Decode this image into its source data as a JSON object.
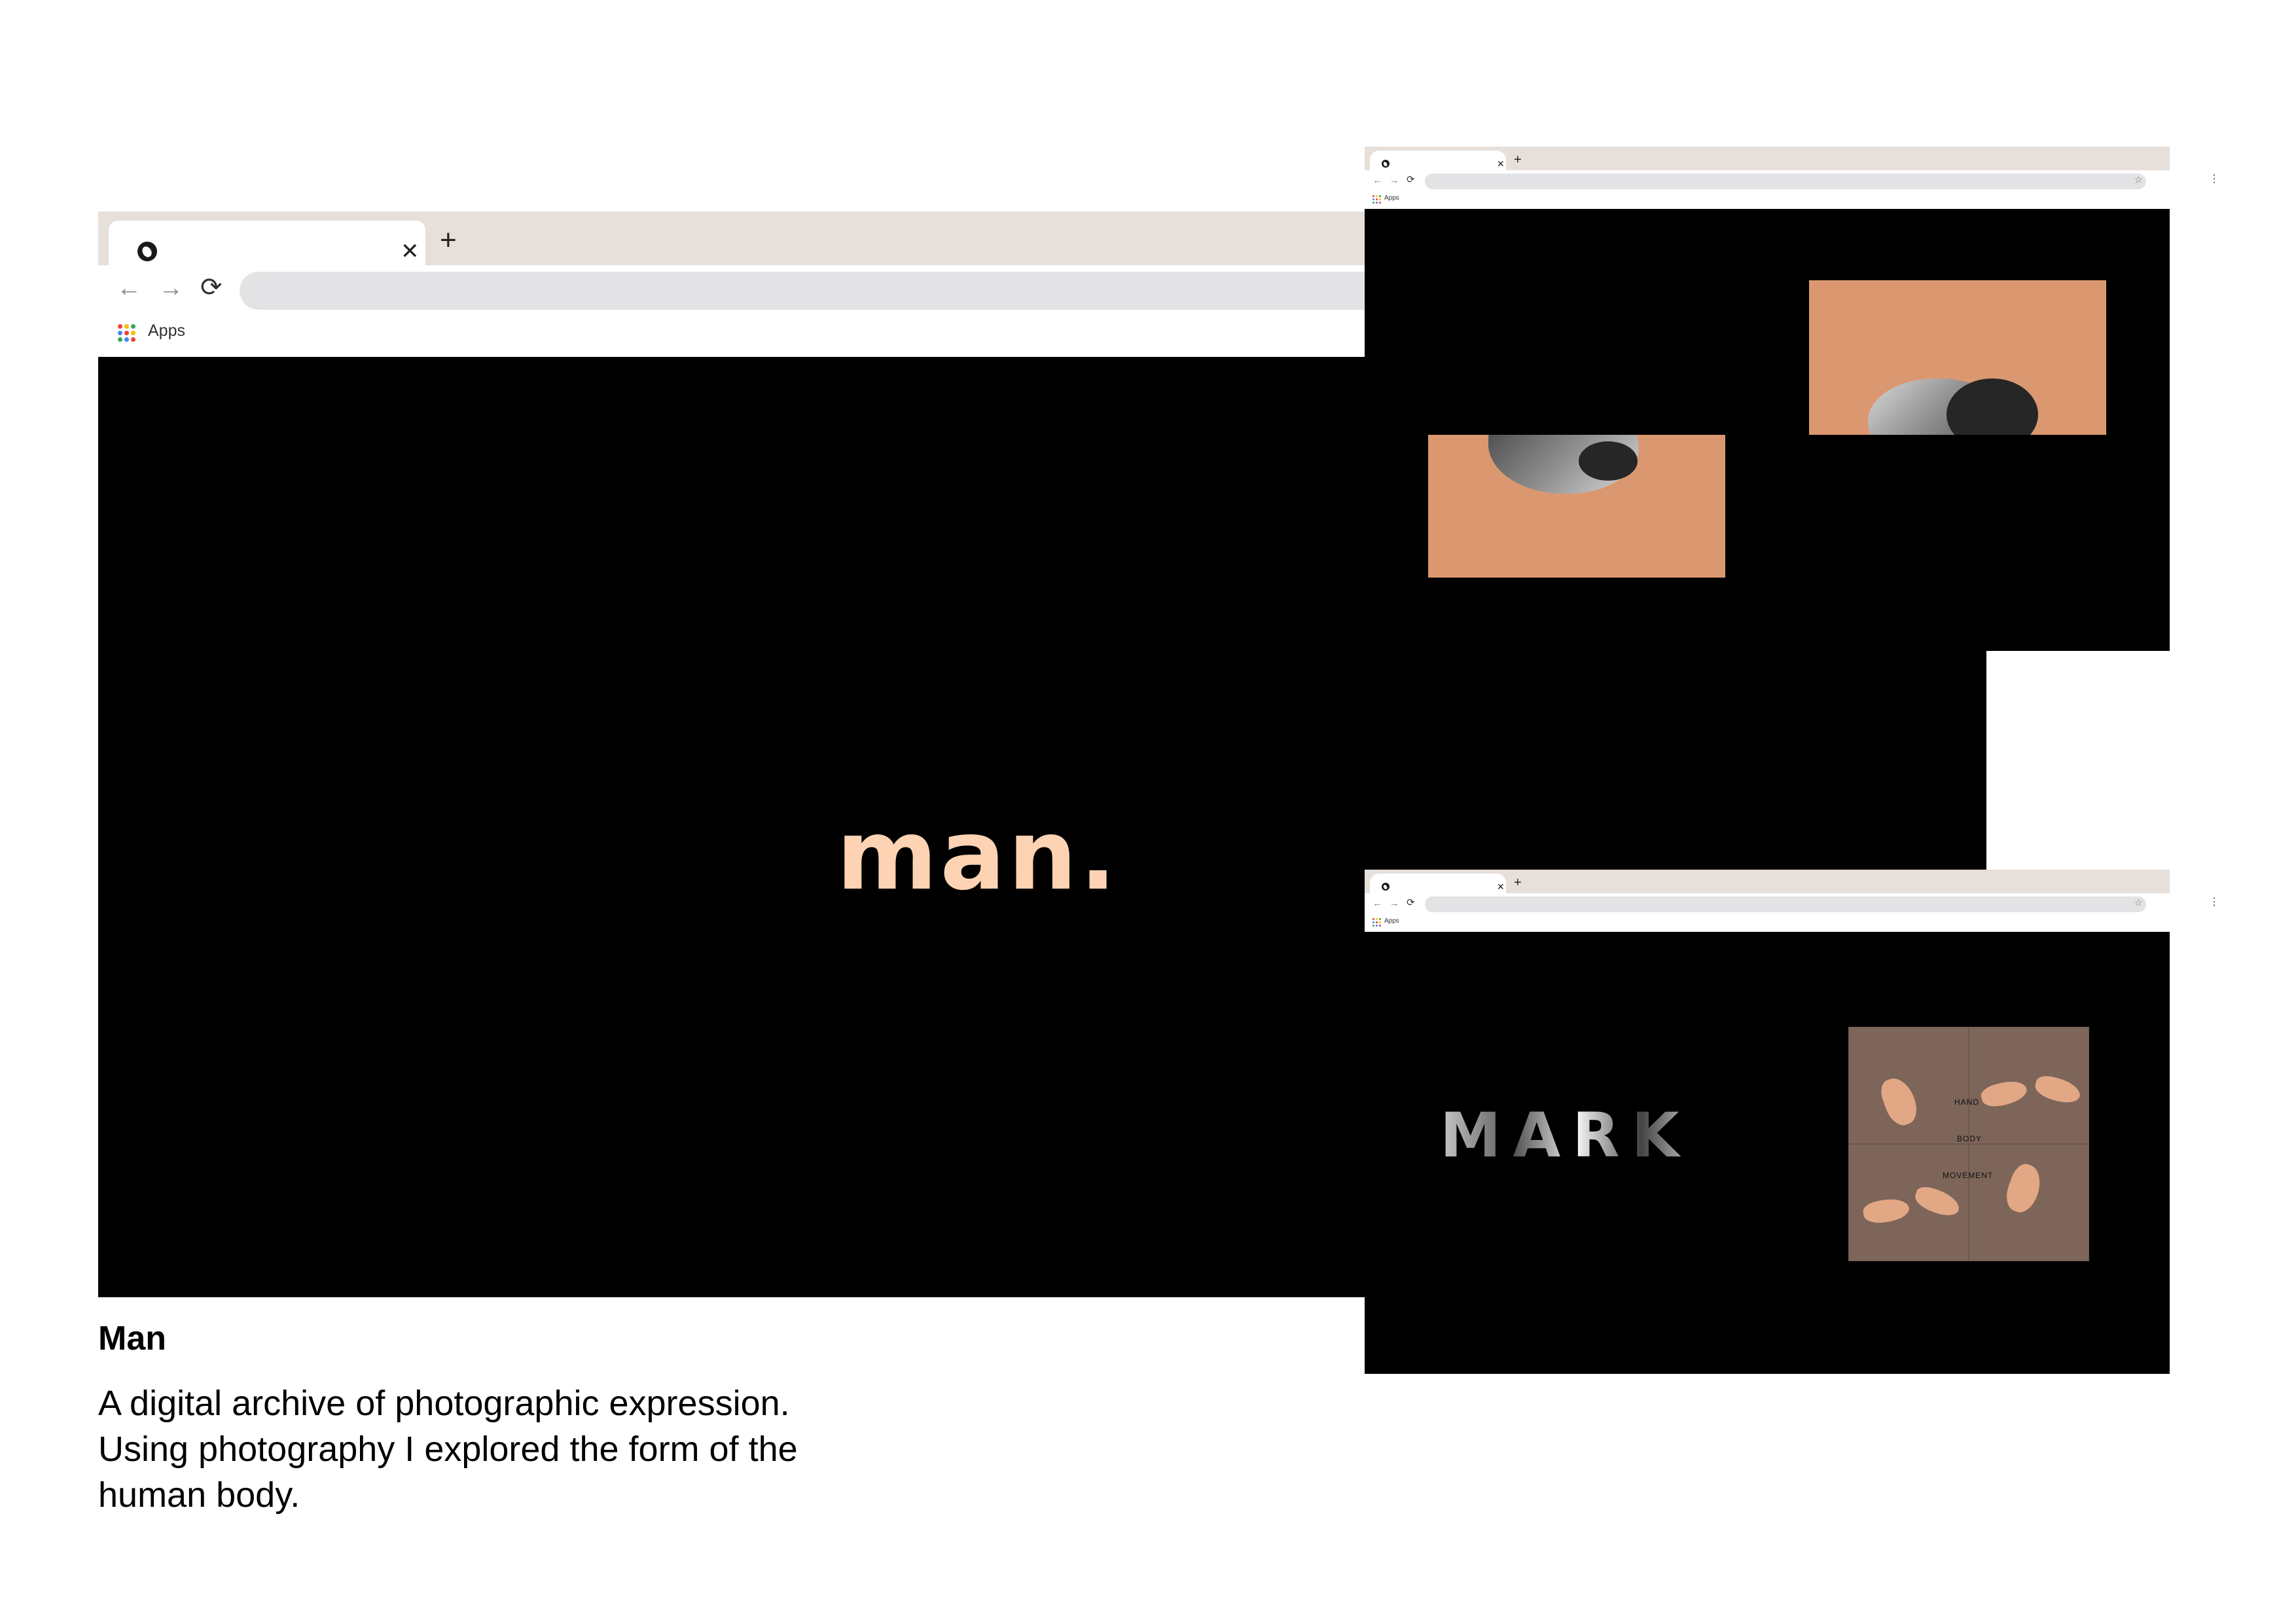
{
  "main_window": {
    "tab_close": "✕",
    "new_tab": "+",
    "nav": {
      "back": "←",
      "forward": "→",
      "reload": "⟳"
    },
    "bookmarks": {
      "apps_label": "Apps"
    },
    "page_word": "man."
  },
  "small_window_top": {
    "tab_close": "✕",
    "new_tab": "+",
    "nav": {
      "back": "←",
      "forward": "→",
      "reload": "⟳"
    },
    "bookmarks": {
      "apps_label": "Apps"
    }
  },
  "small_window_bottom": {
    "tab_close": "✕",
    "new_tab": "+",
    "nav": {
      "back": "←",
      "forward": "→",
      "reload": "⟳"
    },
    "bookmarks": {
      "apps_label": "Apps"
    },
    "mark_word": "MARK",
    "panel_words": [
      "HAND",
      "BODY",
      "MOVEMENT"
    ]
  },
  "project": {
    "title": "Man",
    "description": "A digital archive of photographic expression.\nUsing photography I explored the form of the\nhuman body."
  },
  "colors": {
    "tab_strip": "#e6dfda",
    "accent_peach": "#fdd3b3",
    "orange_panel": "#db9870",
    "hands_panel": "#7d655a",
    "page_bg": "#000000"
  },
  "icons": [
    "globe-icon",
    "close-icon",
    "plus-icon",
    "back-arrow-icon",
    "forward-arrow-icon",
    "reload-icon",
    "apps-grid-icon",
    "star-icon",
    "menu-icon"
  ]
}
